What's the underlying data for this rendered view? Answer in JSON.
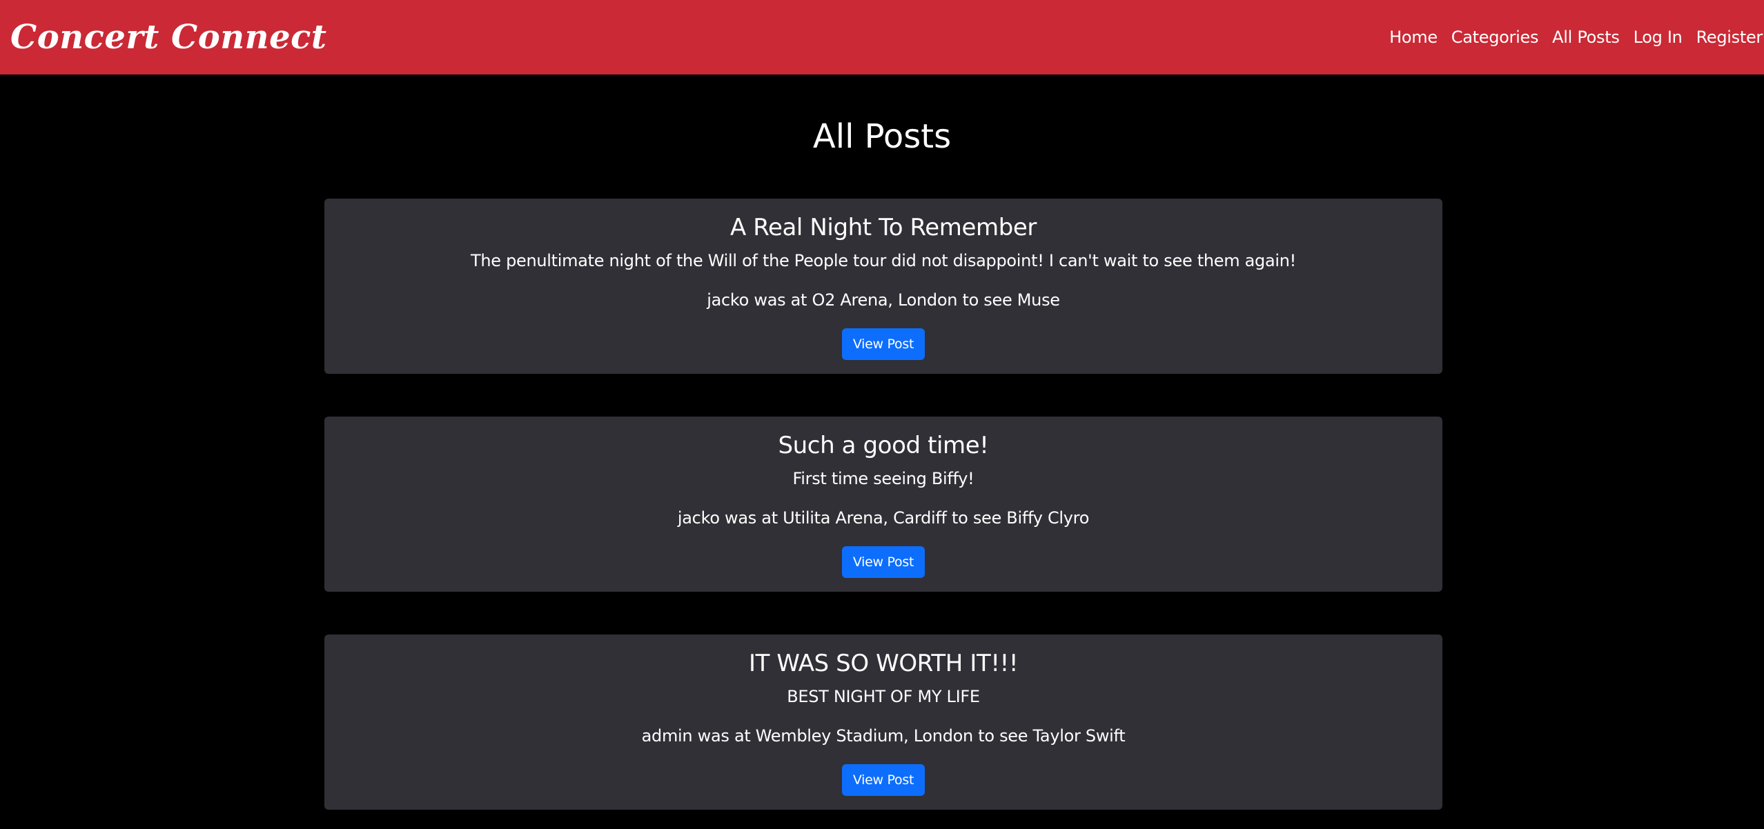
{
  "navbar": {
    "brand": "Concert Connect",
    "links": [
      {
        "label": "Home"
      },
      {
        "label": "Categories"
      },
      {
        "label": "All Posts"
      },
      {
        "label": "Log In"
      },
      {
        "label": "Register"
      }
    ]
  },
  "page": {
    "title": "All Posts"
  },
  "posts": [
    {
      "title": "A Real Night To Remember",
      "body": "The penultimate night of the Will of the People tour did not disappoint! I can't wait to see them again!",
      "meta": "jacko was at O2 Arena, London to see Muse",
      "button_label": "View Post"
    },
    {
      "title": "Such a good time!",
      "body": "First time seeing Biffy!",
      "meta": "jacko was at Utilita Arena, Cardiff to see Biffy Clyro",
      "button_label": "View Post"
    },
    {
      "title": "IT WAS SO WORTH IT!!!",
      "body": "BEST NIGHT OF MY LIFE",
      "meta": "admin was at Wembley Stadium, London to see Taylor Swift",
      "button_label": "View Post"
    }
  ],
  "colors": {
    "navbar_bg": "#cb2936",
    "page_bg": "#000000",
    "card_bg": "#313036",
    "button_bg": "#0d6efd"
  }
}
